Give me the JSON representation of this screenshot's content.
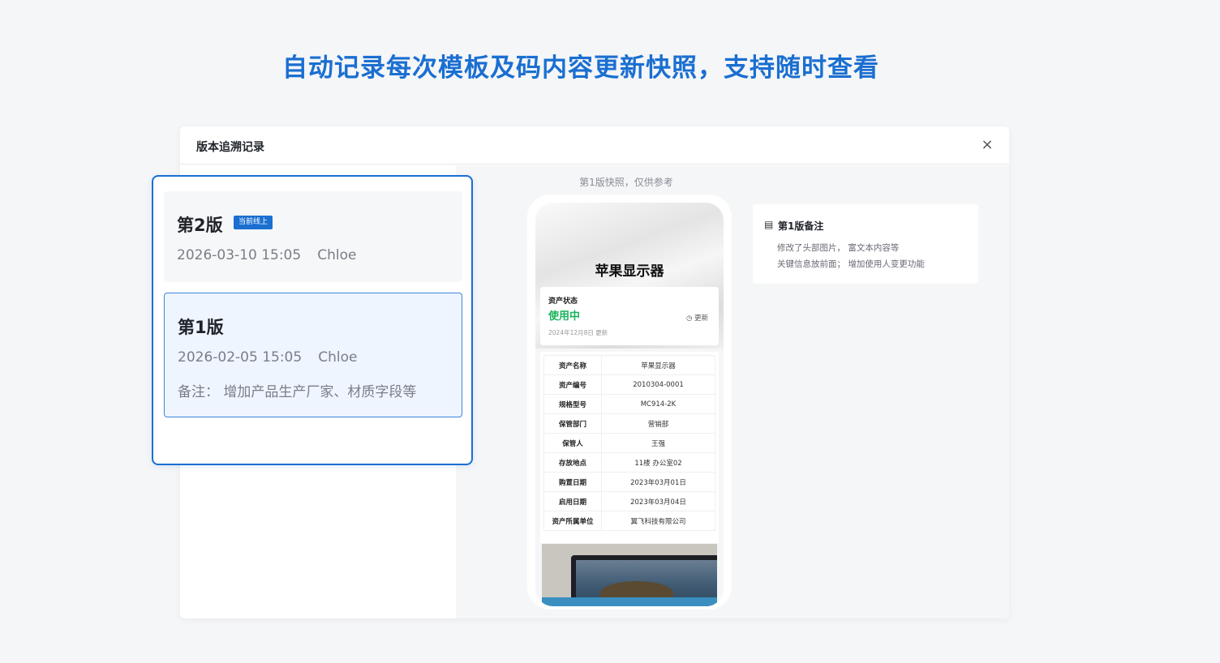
{
  "headline": "自动记录每次模板及码内容更新快照，支持随时查看",
  "modal": {
    "title": "版本追溯记录",
    "close_icon": "×"
  },
  "versions": [
    {
      "name": "第2版",
      "badge": "当前线上",
      "date": "2026-03-10 15:05",
      "author": "Chloe"
    },
    {
      "name": "第1版",
      "date": "2026-02-05 15:05",
      "author": "Chloe",
      "note": "备注： 增加产品生产厂家、材质字段等"
    }
  ],
  "snapshot": {
    "caption": "第1版快照，仅供参考",
    "title": "苹果显示器",
    "status_label": "资产状态",
    "status_value": "使用中",
    "status_date": "2024年12月8日 更新",
    "update_label": "更新",
    "rows": [
      {
        "k": "资产名称",
        "v": "苹果显示器"
      },
      {
        "k": "资产编号",
        "v": "2010304-0001"
      },
      {
        "k": "规格型号",
        "v": "MC914-2K"
      },
      {
        "k": "保管部门",
        "v": "营销部"
      },
      {
        "k": "保管人",
        "v": "王强"
      },
      {
        "k": "存放地点",
        "v": "11楼 办公室02"
      },
      {
        "k": "购置日期",
        "v": "2023年03月01日"
      },
      {
        "k": "启用日期",
        "v": "2023年03月04日"
      },
      {
        "k": "资产所属单位",
        "v": "翼飞科技有限公司"
      }
    ]
  },
  "notes": {
    "title": "第1版备注",
    "lines": [
      "修改了头部图片， 富文本内容等",
      "关键信息放前面； 增加使用人变更功能"
    ]
  },
  "colors": {
    "accent": "#1a6fd1",
    "status_green": "#18b35a",
    "selected_bg": "#eef5fe"
  }
}
